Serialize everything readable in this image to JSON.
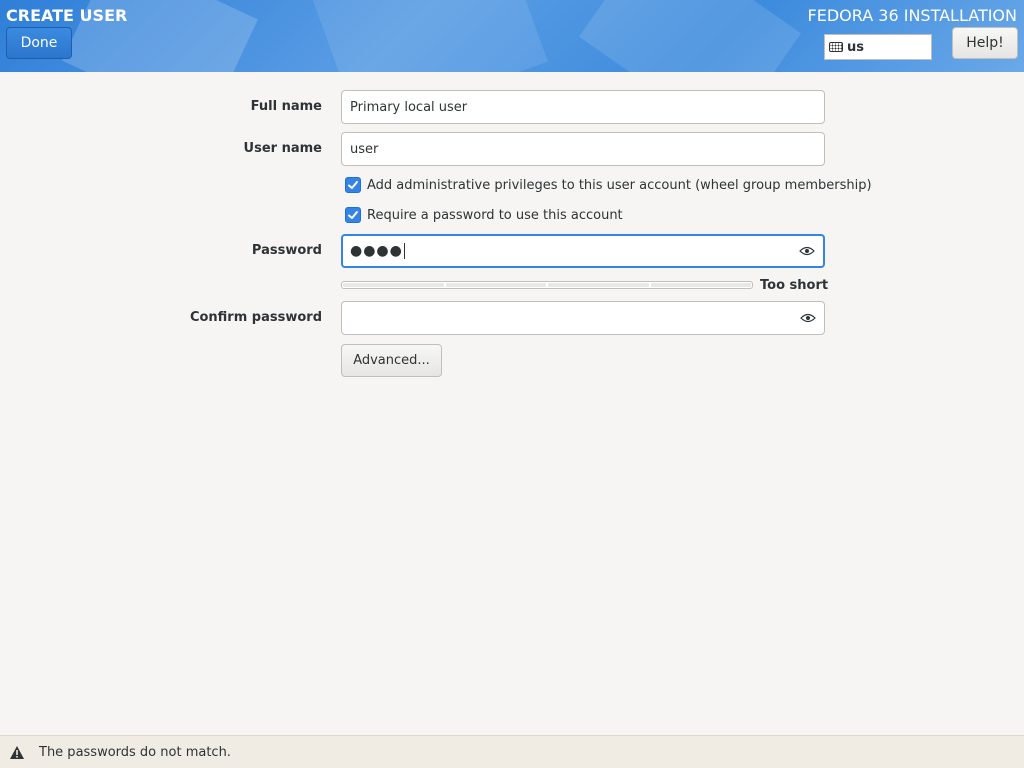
{
  "header": {
    "spoke_title": "CREATE USER",
    "product_title": "FEDORA 36 INSTALLATION",
    "done_label": "Done",
    "help_label": "Help!",
    "keyboard_layout": "us",
    "accent_color": "#3584e4"
  },
  "form": {
    "full_name": {
      "label": "Full name",
      "value": "Primary local user"
    },
    "user_name": {
      "label": "User name",
      "value": "user"
    },
    "admin_checkbox": {
      "label": "Add administrative privileges to this user account (wheel group membership)",
      "checked": true
    },
    "require_password_checkbox": {
      "label": "Require a password to use this account",
      "checked": true
    },
    "password": {
      "label": "Password",
      "value": "●●●●",
      "masked": true
    },
    "strength": {
      "label": "Too short",
      "level": 0.0
    },
    "confirm_password": {
      "label": "Confirm password",
      "value": ""
    },
    "advanced_label": "Advanced..."
  },
  "statusbar": {
    "icon": "warning-icon",
    "message": "The passwords do not match."
  }
}
